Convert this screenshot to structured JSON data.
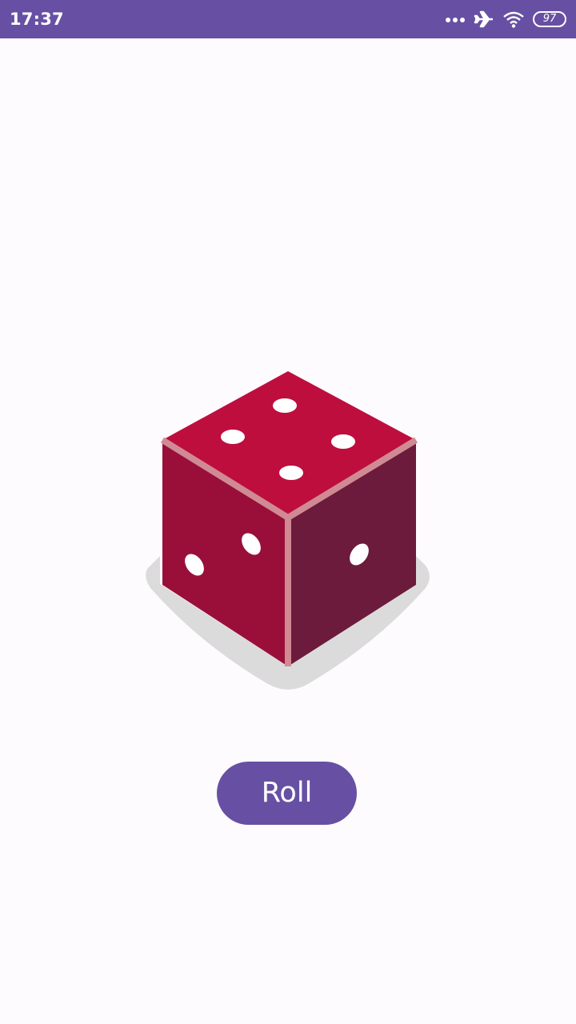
{
  "status_bar": {
    "time": "17:37",
    "battery_level": "97",
    "icons": [
      "more-dots-icon",
      "airplane-mode-icon",
      "wifi-icon",
      "battery-icon"
    ],
    "background_color": "#6750a4"
  },
  "dice": {
    "icon": "dice-icon",
    "top_face_pips": 4,
    "left_face_pips": 2,
    "right_face_pips": 1,
    "colors": {
      "top": "#bd0e3e",
      "left": "#9a0f3a",
      "right": "#6c1b3c",
      "edge": "#d08a94",
      "shadow": "#dcdbdc",
      "pip": "#ffffff"
    }
  },
  "roll_button": {
    "label": "Roll",
    "color": "#6750a4"
  }
}
